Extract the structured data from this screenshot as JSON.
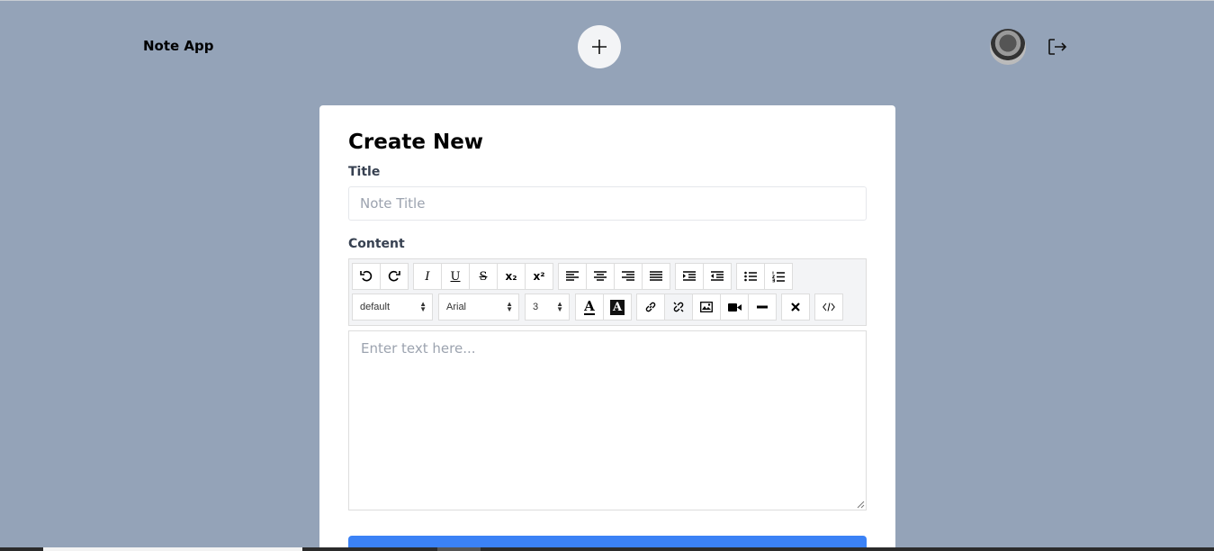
{
  "header": {
    "app_title": "Note App",
    "add_icon": "plus-icon",
    "avatar_icon": "user-avatar",
    "logout_icon": "logout-icon"
  },
  "form": {
    "heading": "Create New",
    "title_label": "Title",
    "title_placeholder": "Note Title",
    "title_value": "",
    "content_label": "Content",
    "editor_placeholder": "Enter text here..."
  },
  "toolbar": {
    "row1": [
      {
        "name": "undo",
        "icon": "undo-icon"
      },
      {
        "name": "redo",
        "icon": "redo-icon"
      },
      {
        "name": "italic",
        "text": "I"
      },
      {
        "name": "underline",
        "text": "U"
      },
      {
        "name": "strikethrough",
        "text": "S"
      },
      {
        "name": "subscript",
        "text": "x₂"
      },
      {
        "name": "superscript",
        "text": "x²"
      },
      {
        "name": "align-left",
        "icon": "align-left-icon"
      },
      {
        "name": "align-center",
        "icon": "align-center-icon"
      },
      {
        "name": "align-right",
        "icon": "align-right-icon"
      },
      {
        "name": "align-justify",
        "icon": "align-justify-icon"
      },
      {
        "name": "indent",
        "icon": "indent-icon"
      },
      {
        "name": "outdent",
        "icon": "outdent-icon"
      },
      {
        "name": "bullet-list",
        "icon": "bullet-list-icon"
      },
      {
        "name": "numbered-list",
        "icon": "numbered-list-icon"
      }
    ],
    "format_select": "default",
    "font_select": "Arial",
    "size_select": "3",
    "font_color_text": "A",
    "highlight_text": "A"
  },
  "colors": {
    "background": "#94a3b8",
    "accent": "#3b82f6",
    "card": "#ffffff"
  }
}
